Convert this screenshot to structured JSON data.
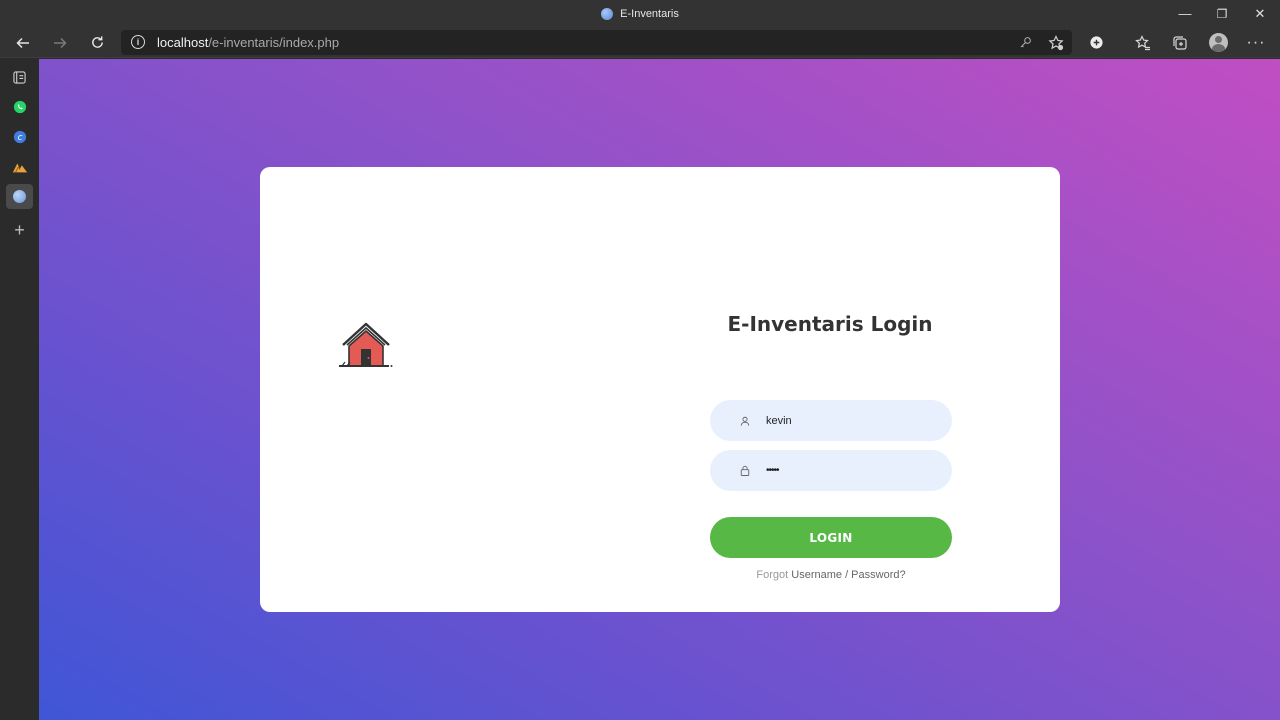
{
  "window": {
    "title": "E-Inventaris",
    "controls": {
      "minimize": "—",
      "restore": "❐",
      "close": "✕"
    }
  },
  "browser": {
    "url_host": "localhost",
    "url_path": "/e-inventaris/index.php",
    "icons": [
      "back-icon",
      "forward-icon",
      "refresh-icon",
      "info-icon",
      "key-icon",
      "add-favorite-icon",
      "extension-icon",
      "favorites-icon",
      "collections-icon",
      "profile-icon",
      "more-icon"
    ]
  },
  "sidebar": {
    "items": [
      {
        "name": "sidebar-item-tab-actions",
        "color": "#d0d0d0"
      },
      {
        "name": "sidebar-item-whatsapp",
        "color": "#25d366"
      },
      {
        "name": "sidebar-item-c-app",
        "color": "#3f7de0"
      },
      {
        "name": "sidebar-item-mountain-app",
        "color": "#e8a33c"
      },
      {
        "name": "sidebar-item-e-inventaris",
        "color": "#8db3e8"
      }
    ],
    "add_label": "+"
  },
  "login": {
    "title": "E-Inventaris Login",
    "username_value": "kevin",
    "password_value": "•••••",
    "button_label": "LOGIN",
    "forgot_prefix": "Forgot",
    "forgot_link": "Username / Password?"
  },
  "colors": {
    "button_green": "#57b846",
    "field_bg": "#e8f0fe",
    "gradient_start": "#3f56d6",
    "gradient_end": "#c14ec3"
  }
}
